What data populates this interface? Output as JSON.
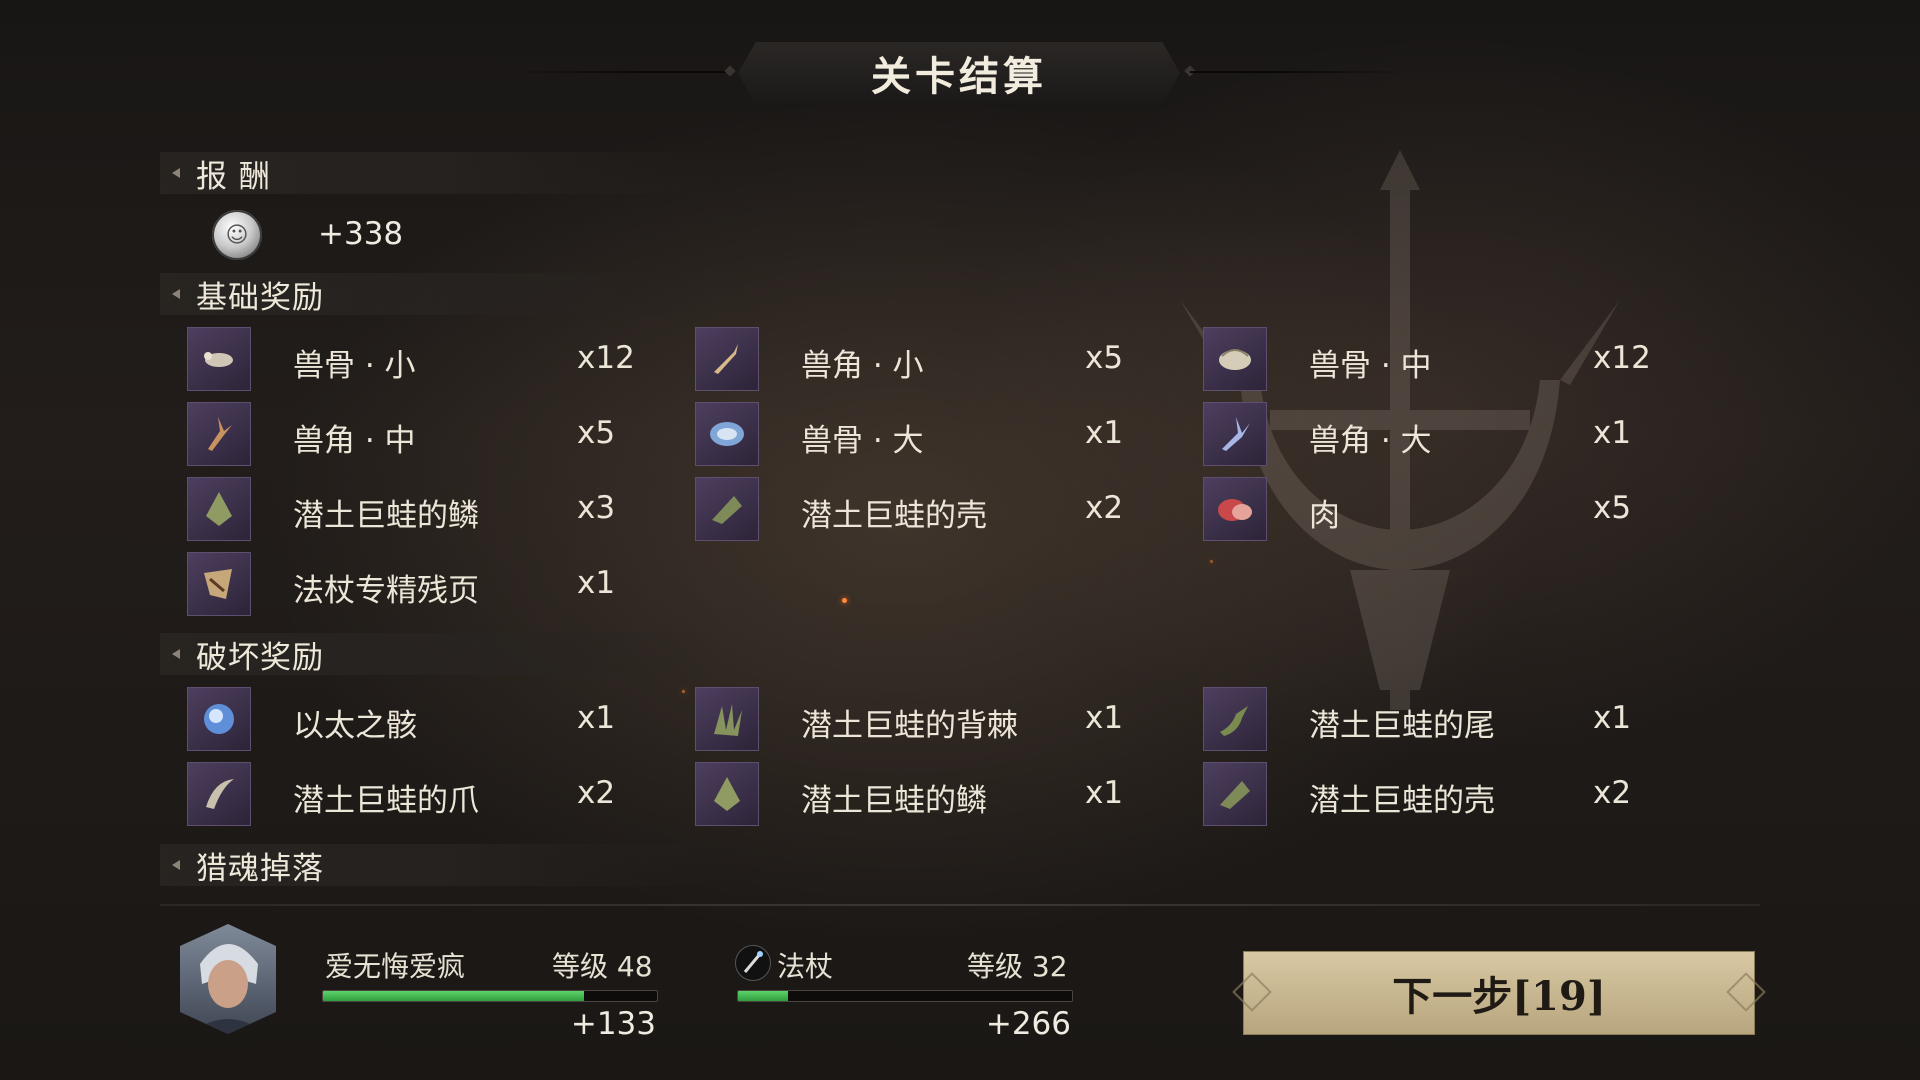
{
  "title": "关卡结算",
  "sections": {
    "reward": {
      "label": "报 酬",
      "coin_value": "+338"
    },
    "basic": {
      "label": "基础奖励",
      "items": [
        {
          "name": "兽骨 · 小",
          "qty": "x12",
          "icon": "bone-small-icon"
        },
        {
          "name": "兽角 · 小",
          "qty": "x5",
          "icon": "horn-small-icon"
        },
        {
          "name": "兽骨 · 中",
          "qty": "x12",
          "icon": "bone-medium-icon"
        },
        {
          "name": "兽角 · 中",
          "qty": "x5",
          "icon": "horn-medium-icon"
        },
        {
          "name": "兽骨 · 大",
          "qty": "x1",
          "icon": "bone-large-icon"
        },
        {
          "name": "兽角 · 大",
          "qty": "x1",
          "icon": "horn-large-icon"
        },
        {
          "name": "潜土巨蛙的鳞",
          "qty": "x3",
          "icon": "scale-icon"
        },
        {
          "name": "潜土巨蛙的壳",
          "qty": "x2",
          "icon": "shell-icon"
        },
        {
          "name": "肉",
          "qty": "x5",
          "icon": "meat-icon"
        },
        {
          "name": "法杖专精残页",
          "qty": "x1",
          "icon": "page-fragment-icon"
        }
      ]
    },
    "break": {
      "label": "破坏奖励",
      "items": [
        {
          "name": "以太之骸",
          "qty": "x1",
          "icon": "ether-remains-icon"
        },
        {
          "name": "潜土巨蛙的背棘",
          "qty": "x1",
          "icon": "back-spine-icon"
        },
        {
          "name": "潜土巨蛙的尾",
          "qty": "x1",
          "icon": "tail-icon"
        },
        {
          "name": "潜土巨蛙的爪",
          "qty": "x2",
          "icon": "claw-icon"
        },
        {
          "name": "潜土巨蛙的鳞",
          "qty": "x1",
          "icon": "scale-icon"
        },
        {
          "name": "潜土巨蛙的壳",
          "qty": "x2",
          "icon": "shell-icon"
        }
      ]
    },
    "soul": {
      "label": "猎魂掉落"
    }
  },
  "player": {
    "name": "爱无悔爱疯",
    "level_label": "等级 48",
    "exp_fill": 0.78,
    "exp_gain": "+133"
  },
  "weapon": {
    "name": "法杖",
    "level_label": "等级 32",
    "exp_fill": 0.15,
    "exp_gain": "+266",
    "icon": "staff-icon"
  },
  "next_button": {
    "label": "下一步[19]"
  },
  "colors": {
    "icon_bg": "#3d3150",
    "exp_bar": "#3fbf4f",
    "button_bg": "#cdbd95"
  }
}
